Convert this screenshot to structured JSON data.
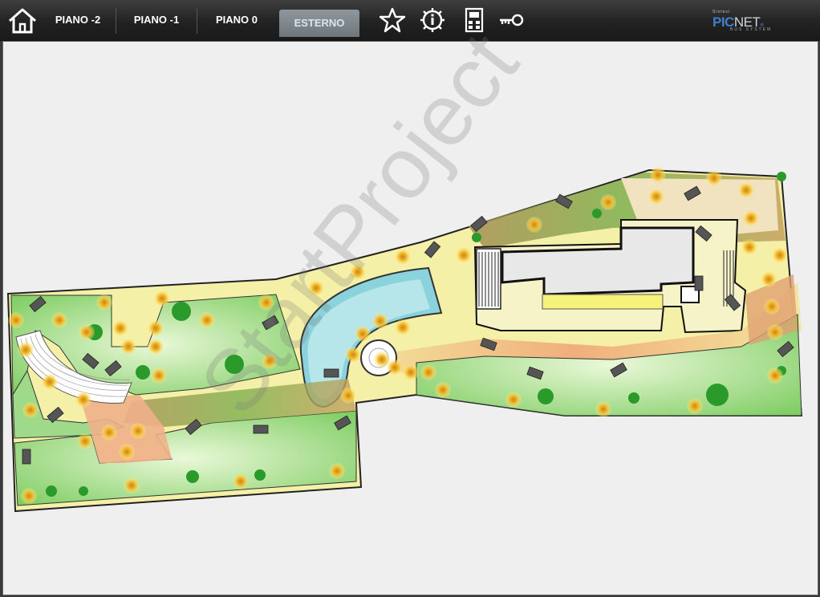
{
  "nav": {
    "home_icon": "home-icon",
    "tabs": [
      {
        "label": "PIANO -2",
        "active": false
      },
      {
        "label": "PIANO -1",
        "active": false
      },
      {
        "label": "PIANO 0",
        "active": false
      },
      {
        "label": "ESTERNO",
        "active": true
      }
    ],
    "tools": [
      "star-icon",
      "info-settings-icon",
      "intercom-icon",
      "key-icon"
    ]
  },
  "brand": {
    "small": "Sintesi",
    "pic": "PIC",
    "net": "NET",
    "suffix": "®",
    "sub": "BUS SYSTEM"
  },
  "watermark": "StartProject",
  "colors": {
    "lawn": "#8fd27a",
    "light": "#f2c63b",
    "water": "#7fd0dc",
    "path": "#f4f0a0",
    "terrace": "#e6d5a8"
  }
}
